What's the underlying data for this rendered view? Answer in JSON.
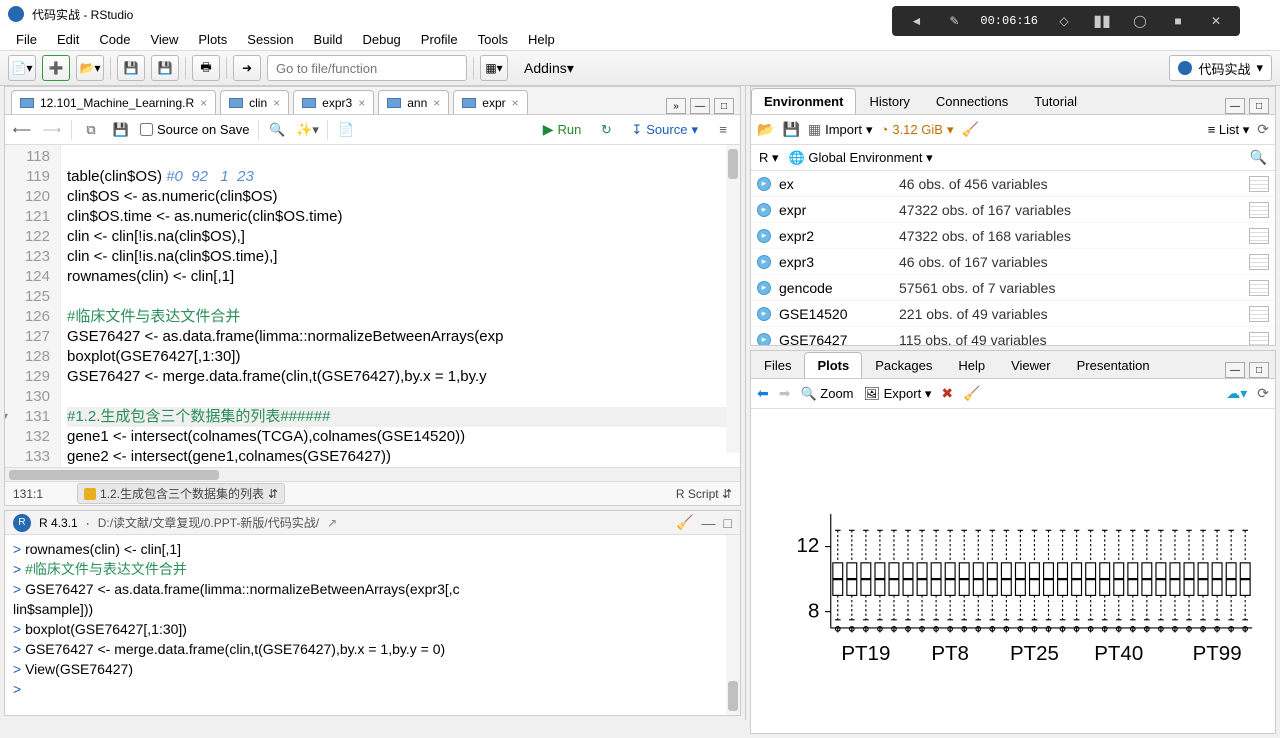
{
  "window": {
    "title": "代码实战 - RStudio"
  },
  "recording": {
    "time": "00:06:16"
  },
  "menubar": [
    "File",
    "Edit",
    "Code",
    "View",
    "Plots",
    "Session",
    "Build",
    "Debug",
    "Profile",
    "Tools",
    "Help"
  ],
  "toolbar": {
    "goto_placeholder": "Go to file/function",
    "addins": "Addins",
    "project": "代码实战"
  },
  "tabs": [
    {
      "label": "12.101_Machine_Learning.R"
    },
    {
      "label": "clin"
    },
    {
      "label": "expr3"
    },
    {
      "label": "ann"
    },
    {
      "label": "expr"
    }
  ],
  "source_toolbar": {
    "source_on_save": "Source on Save",
    "run": "Run",
    "source": "Source"
  },
  "code_lines": [
    {
      "n": "118",
      "t": ""
    },
    {
      "n": "119",
      "t": "table(clin$OS) ",
      "tail": "#0  92   1  23",
      "cls": "hash"
    },
    {
      "n": "120",
      "t": "clin$OS <- as.numeric(clin$OS)"
    },
    {
      "n": "121",
      "t": "clin$OS.time <- as.numeric(clin$OS.time)"
    },
    {
      "n": "122",
      "t": "clin <- clin[!is.na(clin$OS),]"
    },
    {
      "n": "123",
      "t": "clin <- clin[!is.na(clin$OS.time),]"
    },
    {
      "n": "124",
      "t": "rownames(clin) <- clin[,1]"
    },
    {
      "n": "125",
      "t": ""
    },
    {
      "n": "126",
      "t": "#临床文件与表达文件合并",
      "cls": "cmt"
    },
    {
      "n": "127",
      "t": "GSE76427 <- as.data.frame(limma::normalizeBetweenArrays(exp"
    },
    {
      "n": "128",
      "t": "boxplot(GSE76427[,1:30])"
    },
    {
      "n": "129",
      "t": "GSE76427 <- merge.data.frame(clin,t(GSE76427),by.x = 1,by.y"
    },
    {
      "n": "130",
      "t": ""
    },
    {
      "n": "131",
      "t": "#1.2.生成包含三个数据集的列表######",
      "cls": "cmt",
      "active": true,
      "fold": true
    },
    {
      "n": "132",
      "t": "gene1 <- intersect(colnames(TCGA),colnames(GSE14520))"
    },
    {
      "n": "133",
      "t": "gene2 <- intersect(gene1,colnames(GSE76427))"
    },
    {
      "n": "134",
      "t": ""
    },
    {
      "n": "135",
      "t": ""
    }
  ],
  "source_status": {
    "cursor": "131:1",
    "chunk": "1.2.生成包含三个数据集的列表",
    "ftype": "R Script"
  },
  "console": {
    "rver": "R 4.3.1",
    "path": "D:/读文献/文章复现/0.PPT-新版/代码实战/",
    "lines": [
      {
        "p": ">",
        "t": " rownames(clin) <- clin[,1]"
      },
      {
        "p": ">",
        "t": " #临床文件与表达文件合并",
        "cls": "cmt"
      },
      {
        "p": ">",
        "t": " GSE76427 <- as.data.frame(limma::normalizeBetweenArrays(expr3[,c"
      },
      {
        "p": "",
        "t": "lin$sample]))"
      },
      {
        "p": ">",
        "t": " boxplot(GSE76427[,1:30])"
      },
      {
        "p": ">",
        "t": " GSE76427 <- merge.data.frame(clin,t(GSE76427),by.x = 1,by.y = 0)"
      },
      {
        "p": ">",
        "t": " View(GSE76427)"
      },
      {
        "p": ">",
        "t": " "
      }
    ]
  },
  "env_tabs": [
    "Environment",
    "History",
    "Connections",
    "Tutorial"
  ],
  "env_toolbar": {
    "import": "Import",
    "mem": "3.12 GiB",
    "list": "List"
  },
  "env_scope": {
    "lang": "R",
    "scope": "Global Environment"
  },
  "env_rows": [
    {
      "name": "ex",
      "desc": "46 obs. of 456 variables"
    },
    {
      "name": "expr",
      "desc": "47322 obs. of 167 variables"
    },
    {
      "name": "expr2",
      "desc": "47322 obs. of 168 variables"
    },
    {
      "name": "expr3",
      "desc": "46 obs. of 167 variables"
    },
    {
      "name": "gencode",
      "desc": "57561 obs. of 7 variables"
    },
    {
      "name": "GSE14520",
      "desc": "221 obs. of 49 variables"
    },
    {
      "name": "GSE76427",
      "desc": "115 obs. of 49 variables"
    }
  ],
  "plot_tabs": [
    "Files",
    "Plots",
    "Packages",
    "Help",
    "Viewer",
    "Presentation"
  ],
  "plot_toolbar": {
    "zoom": "Zoom",
    "export": "Export"
  },
  "chart_data": {
    "type": "boxplot",
    "title": "",
    "xlabel": "",
    "ylabel": "",
    "y_ticks": [
      8,
      12
    ],
    "x_categories_shown": [
      "PT19",
      "PT8",
      "PT25",
      "PT40",
      "PT99"
    ],
    "n_boxes": 30,
    "box_summary": {
      "median": 10,
      "q1": 9,
      "q3": 11,
      "whisker_low": 7.5,
      "whisker_high": 13
    },
    "note": "All 30 boxes appear nearly identical after normalizeBetweenArrays; medians ~10, IQR ~[9,11], whiskers ~[7.5,13], outliers below whiskers."
  }
}
